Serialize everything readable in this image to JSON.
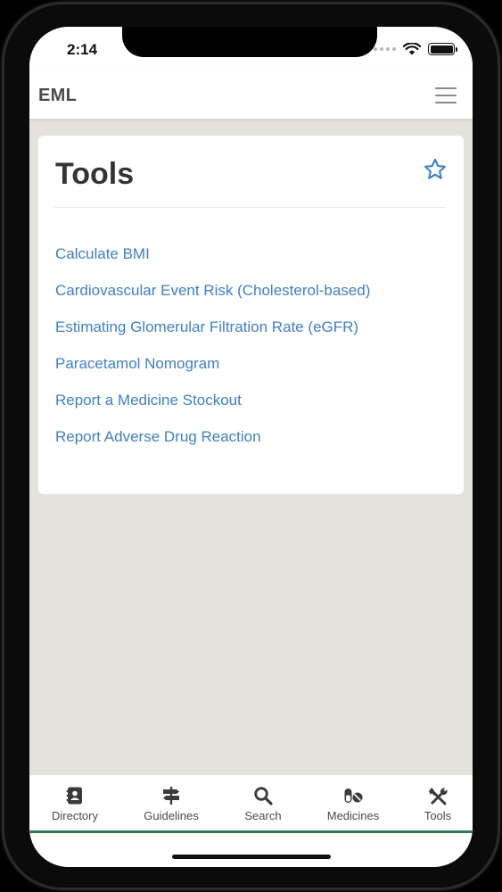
{
  "status": {
    "time": "2:14"
  },
  "header": {
    "brand": "EML"
  },
  "page": {
    "title": "Tools"
  },
  "tools": [
    {
      "label": "Calculate BMI"
    },
    {
      "label": "Cardiovascular Event Risk (Cholesterol-based)"
    },
    {
      "label": "Estimating Glomerular Filtration Rate (eGFR)"
    },
    {
      "label": "Paracetamol Nomogram"
    },
    {
      "label": "Report a Medicine Stockout"
    },
    {
      "label": "Report Adverse Drug Reaction"
    }
  ],
  "tabs": [
    {
      "label": "Directory",
      "icon": "address-book-icon"
    },
    {
      "label": "Guidelines",
      "icon": "signpost-icon"
    },
    {
      "label": "Search",
      "icon": "search-icon"
    },
    {
      "label": "Medicines",
      "icon": "pills-icon"
    },
    {
      "label": "Tools",
      "icon": "tools-icon"
    }
  ],
  "colors": {
    "link": "#3f7fc7",
    "tab_accent": "#2e7a4b",
    "background": "#e3e2dd"
  }
}
